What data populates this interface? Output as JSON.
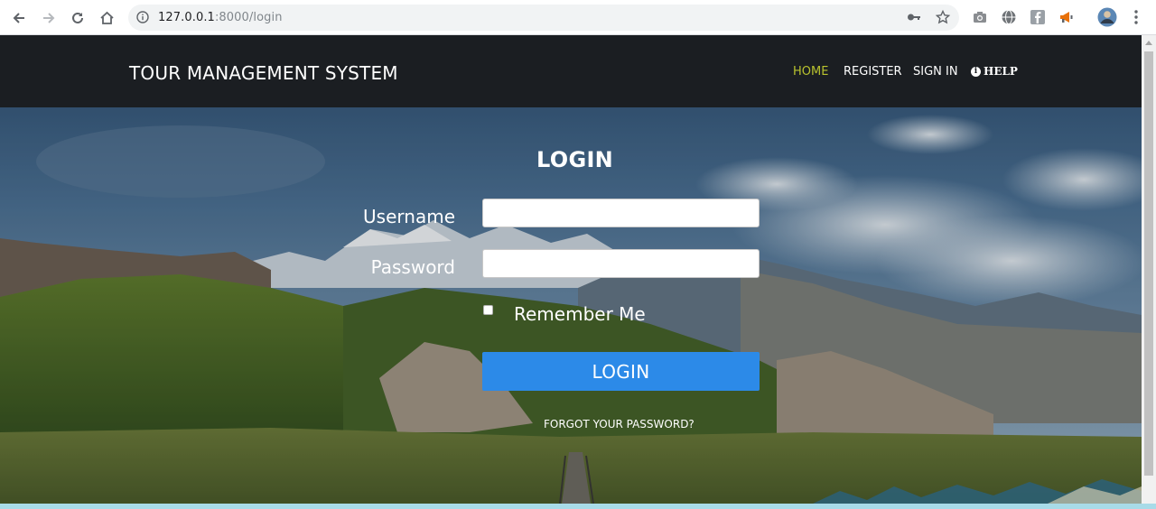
{
  "browser": {
    "url_host": "127.0.0.1",
    "url_rest": ":8000/login"
  },
  "navbar": {
    "brand": "TOUR MANAGEMENT SYSTEM",
    "links": {
      "home": "HOME",
      "register": "REGISTER",
      "sign_in": "SIGN IN",
      "help": "HELP"
    },
    "active_color": "#b9c22e",
    "background": "#1b1e22"
  },
  "login_form": {
    "title": "LOGIN",
    "username_label": "Username",
    "username_value": "",
    "password_label": "Password",
    "password_value": "",
    "remember_label": "Remember Me",
    "remember_checked": false,
    "submit_label": "LOGIN",
    "submit_color": "#2c8ae8",
    "forgot_label": "FORGOT YOUR PASSWORD?"
  },
  "icons": {
    "back": "arrow-left-icon",
    "forward": "arrow-right-icon",
    "reload": "reload-icon",
    "home": "home-icon",
    "site_info": "info-icon",
    "key": "key-icon",
    "bookmark": "star-icon",
    "camera": "camera-icon",
    "globe": "globe-icon",
    "facebook": "facebook-icon",
    "megaphone": "megaphone-icon",
    "avatar": "avatar-icon",
    "menu": "kebab-menu-icon"
  }
}
